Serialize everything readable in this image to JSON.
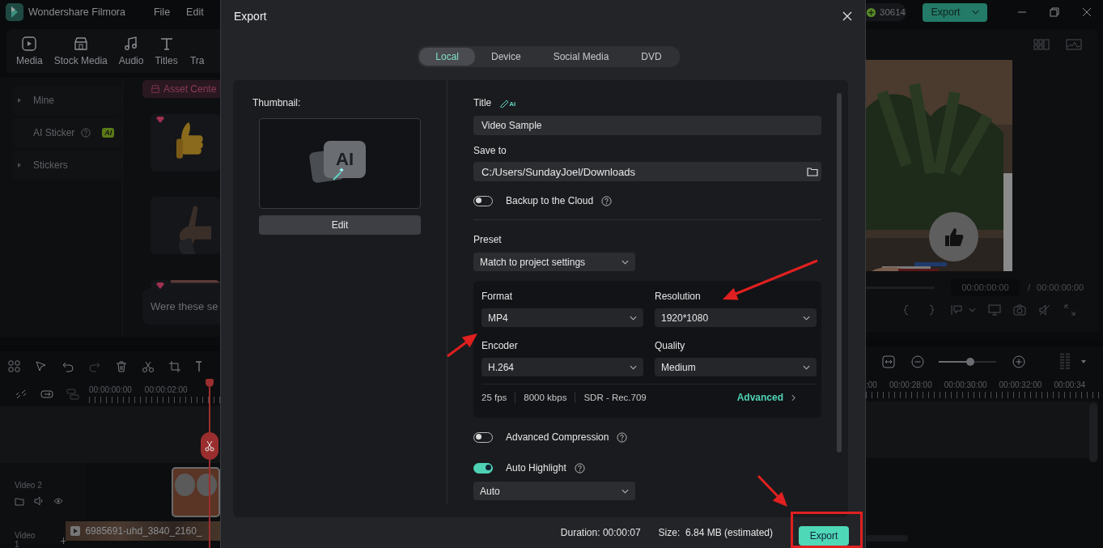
{
  "app": {
    "title": "Wondershare Filmora",
    "menu": [
      "File",
      "Edit"
    ],
    "credits": "30614",
    "export_button": "Export",
    "toolbar": [
      {
        "label": "Media",
        "kind": "media"
      },
      {
        "label": "Stock Media",
        "kind": "stock"
      },
      {
        "label": "Audio",
        "kind": "audio"
      },
      {
        "label": "Titles",
        "kind": "titles"
      },
      {
        "label": "Tra",
        "kind": "none"
      }
    ],
    "sidebar": [
      {
        "label": "Mine",
        "kind": "group"
      },
      {
        "label": "AI Sticker",
        "kind": "ai",
        "badge": "AI"
      },
      {
        "label": "Stickers",
        "kind": "group"
      }
    ],
    "asset_center": "Asset Cente",
    "stickers": [
      {
        "premium": true
      },
      {
        "premium": false
      },
      {
        "premium": true
      }
    ],
    "feedback": "Were these se",
    "preview": {
      "progress": {
        "level": 0
      },
      "timecode": "00:00:00:00",
      "separator": "/",
      "duration": "00:00:00:00"
    },
    "timeline": {
      "ruler_left": [
        "00:00:00:00",
        "00:00:02:00"
      ],
      "ruler_right": [
        ":00",
        "00:00:28:00",
        "00:00:30:00",
        "00:00:32:00",
        "00:00:34"
      ],
      "tracks": [
        {
          "label": "Video 2"
        },
        {
          "label": "Video 1"
        }
      ],
      "clip_name": "6985691-uhd_3840_2160_",
      "zoom": {
        "level": 0.55
      }
    }
  },
  "dialog": {
    "title": "Export",
    "tabs": [
      {
        "label": "Local",
        "selected": true
      },
      {
        "label": "Device",
        "selected": false
      },
      {
        "label": "Social Media",
        "selected": false
      },
      {
        "label": "DVD",
        "selected": false
      }
    ],
    "thumbnail_label": "Thumbnail:",
    "thumbnail_text": "AI",
    "edit_button": "Edit",
    "title_label": "Title",
    "title_icon_text": "AI",
    "title_value": "Video Sample",
    "save_label": "Save to",
    "save_value": "C:/Users/SundayJoel/Downloads",
    "backup": {
      "label": "Backup to the Cloud",
      "on": false
    },
    "preset": {
      "label": "Preset",
      "value": "Match to project settings"
    },
    "format_fields": [
      {
        "label": "Format",
        "value": "MP4"
      },
      {
        "label": "Resolution",
        "value": "1920*1080"
      },
      {
        "label": "Encoder",
        "value": "H.264"
      },
      {
        "label": "Quality",
        "value": "Medium"
      }
    ],
    "specs": [
      "25 fps",
      "8000 kbps",
      "SDR - Rec.709"
    ],
    "advanced_link": "Advanced",
    "options": [
      {
        "label": "Advanced Compression",
        "on": false
      },
      {
        "label": "Auto Highlight",
        "on": true
      }
    ],
    "highlight_mode": "Auto",
    "duration_label": "Duration:",
    "duration": "00:00:07",
    "size_label": "Size:",
    "size": "6.84 MB (estimated)",
    "export_button": "Export"
  }
}
